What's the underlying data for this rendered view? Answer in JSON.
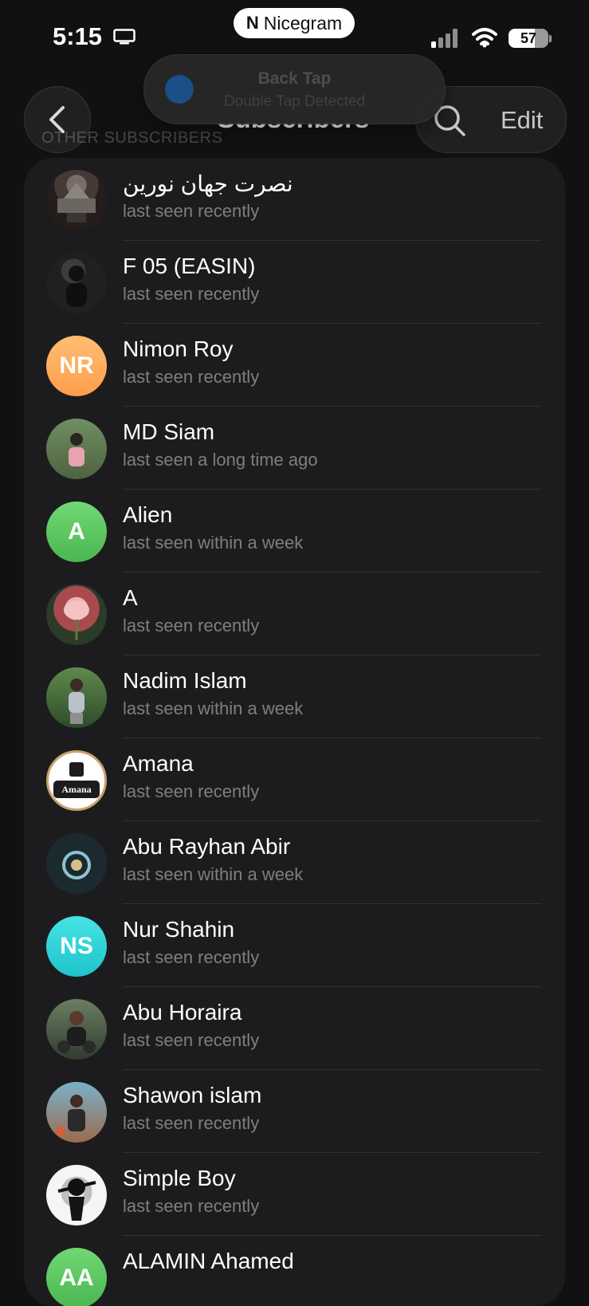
{
  "status_bar": {
    "time": "5:15",
    "carrier_pill": "Nicegram",
    "battery": "57"
  },
  "toast": {
    "title": "Back Tap",
    "subtitle": "Double Tap Detected"
  },
  "header": {
    "title": "Subscribers",
    "section": "OTHER SUBSCRIBERS",
    "edit_label": "Edit"
  },
  "subscribers": [
    {
      "name": "نصرت جهان نورین",
      "status": "last seen recently",
      "avatar": "photo"
    },
    {
      "name": "F 05 (EASIN)",
      "status": "last seen recently",
      "avatar": "photo"
    },
    {
      "name": "Nimon Roy",
      "status": "last seen recently",
      "avatar": "NR",
      "color": "#ffad62"
    },
    {
      "name": "MD Siam",
      "status": "last seen a long time ago",
      "avatar": "photo"
    },
    {
      "name": "Alien",
      "status": "last seen within a week",
      "avatar": "A",
      "color": "#62c865"
    },
    {
      "name": "A",
      "status": "last seen recently",
      "avatar": "photo"
    },
    {
      "name": "Nadim Islam",
      "status": "last seen within a week",
      "avatar": "photo"
    },
    {
      "name": "Amana",
      "status": "last seen recently",
      "avatar": "Amana",
      "color": "#ffffff"
    },
    {
      "name": "Abu Rayhan Abir",
      "status": "last seen within a week",
      "avatar": "photo"
    },
    {
      "name": "Nur Shahin",
      "status": "last seen recently",
      "avatar": "NS",
      "color": "#2ad6d6"
    },
    {
      "name": "Abu Horaira",
      "status": "last seen recently",
      "avatar": "photo"
    },
    {
      "name": "Shawon islam",
      "status": "last seen recently",
      "avatar": "photo"
    },
    {
      "name": "Simple Boy",
      "status": "last seen recently",
      "avatar": "photo"
    },
    {
      "name": "ALAMIN Ahamed",
      "status": "",
      "avatar": "AA",
      "color": "#62c865"
    }
  ]
}
